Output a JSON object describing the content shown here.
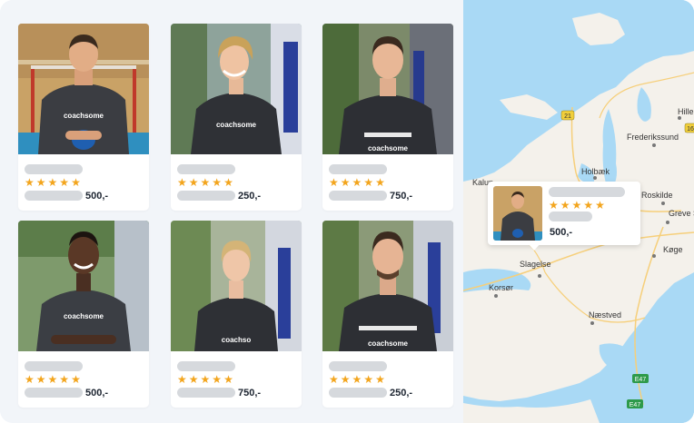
{
  "listings": [
    {
      "price": "500,-",
      "rating_stars": 5,
      "shirt_brand": "coachsome",
      "icon": "person-photo"
    },
    {
      "price": "250,-",
      "rating_stars": 5,
      "shirt_brand": "coachsome",
      "icon": "person-photo"
    },
    {
      "price": "750,-",
      "rating_stars": 5,
      "shirt_brand": "coachsome",
      "icon": "person-photo"
    },
    {
      "price": "500,-",
      "rating_stars": 5,
      "shirt_brand": "coachsome",
      "icon": "person-photo"
    },
    {
      "price": "750,-",
      "rating_stars": 5,
      "shirt_brand": "coachsome",
      "icon": "person-photo"
    },
    {
      "price": "250,-",
      "rating_stars": 5,
      "shirt_brand": "coachsome",
      "icon": "person-photo"
    }
  ],
  "star_glyph": "★",
  "map": {
    "cities": [
      "Hille",
      "Frederikssund",
      "Roskilde",
      "Greve S",
      "Køge",
      "Holbæk",
      "Kalun",
      "Slagelse",
      "Korsør",
      "Næstved"
    ],
    "road_labels": [
      "21",
      "16",
      "E47",
      "E47"
    ],
    "popup": {
      "price": "500,-",
      "rating_stars": 5,
      "shirt_brand": "coachsome"
    }
  },
  "colors": {
    "accent_star": "#f3a51d",
    "skeleton": "#d6d9dd",
    "panel_bg": "#f2f5f9",
    "water": "#a9d9f5",
    "land": "#f4f1eb",
    "road_badge_green": "#2e9a4a"
  }
}
